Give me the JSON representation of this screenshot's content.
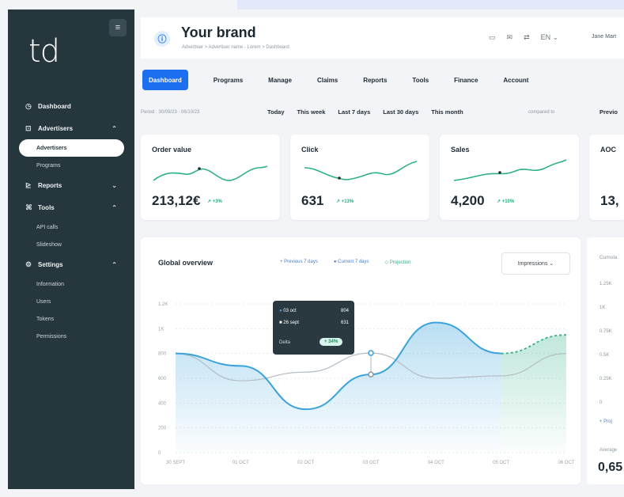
{
  "sidebar": {
    "logo": "td",
    "collapse_icon": "≡",
    "items": [
      {
        "label": "Dashboard",
        "icon": "◷",
        "type": "main"
      },
      {
        "label": "Advertisers",
        "icon": "⊡",
        "type": "main",
        "chev": "⌃"
      },
      {
        "label": "Advertisers",
        "type": "sub",
        "active": true
      },
      {
        "label": "Programs",
        "type": "sub"
      },
      {
        "label": "Reports",
        "icon": "⊵",
        "type": "main",
        "chev": "⌄"
      },
      {
        "label": "Tools",
        "icon": "⌘",
        "type": "main",
        "chev": "⌃"
      },
      {
        "label": "API calls",
        "type": "sub"
      },
      {
        "label": "Slideshow",
        "type": "sub"
      },
      {
        "label": "Settings",
        "icon": "⚙",
        "type": "main",
        "chev": "⌃"
      },
      {
        "label": "Information",
        "type": "sub"
      },
      {
        "label": "Users",
        "type": "sub"
      },
      {
        "label": "Tokens",
        "type": "sub"
      },
      {
        "label": "Permissions",
        "type": "sub"
      }
    ]
  },
  "header": {
    "brand_icon": "ⓘ",
    "title": "Your brand",
    "breadcrumb": "Advertiser  >  Advertiser name - Lorem  >  Dashboard",
    "user": "Jane Mart"
  },
  "tabs": [
    "Dashboard",
    "Programs",
    "Manage",
    "Claims",
    "Reports",
    "Tools",
    "Finance",
    "Account"
  ],
  "period": {
    "label": "Period : 30/09/23 - 06/10/23",
    "buttons": [
      "Today",
      "This week",
      "Last 7 days",
      "Last 30 days",
      "This month"
    ],
    "compared": "compared to",
    "previous": "Previo"
  },
  "kpis": [
    {
      "label": "Order value",
      "value": "213,12€",
      "change": "+3%"
    },
    {
      "label": "Click",
      "value": "631",
      "change": "+13%"
    },
    {
      "label": "Sales",
      "value": "4,200",
      "change": "+10%"
    },
    {
      "label": "AOC",
      "value": "13,"
    }
  ],
  "overview": {
    "title": "Global overview",
    "legend": [
      "Previous 7 days",
      "Current 7 days",
      "Projection"
    ],
    "select": "Impressions",
    "tooltip": {
      "row1": {
        "label": "03 oct",
        "value": "804"
      },
      "row2": {
        "label": "26 sept",
        "value": "631"
      },
      "delta_label": "Delta",
      "delta_value": "+ 34%"
    }
  },
  "chart_data": {
    "type": "line",
    "categories": [
      "30 SEPT",
      "01 OCT",
      "02 OCT",
      "03 OCT",
      "04 OCT",
      "05 OCT",
      "06 OCT"
    ],
    "ylim": [
      0,
      1200
    ],
    "y_ticks": [
      "0",
      "200",
      "400",
      "600",
      "800",
      "1K",
      "1.2K"
    ],
    "series": [
      {
        "name": "Previous 7 days",
        "values": [
          800,
          580,
          650,
          804,
          600,
          620,
          800
        ]
      },
      {
        "name": "Current 7 days",
        "values": [
          800,
          700,
          350,
          631,
          1050,
          800,
          null
        ]
      },
      {
        "name": "Projection",
        "values": [
          null,
          null,
          null,
          null,
          null,
          800,
          950
        ]
      }
    ]
  },
  "rpanel": {
    "title": "Cumula",
    "ticks": [
      "1.25K",
      "1K",
      "0.75K",
      "0.5K",
      "0.25K",
      "0"
    ],
    "link": "+ Proj",
    "avg_label": "Average",
    "avg_value": "0,65"
  },
  "colors": {
    "accent": "#1d6ff1",
    "sidebar": "#26363d",
    "line_blue": "#3aa3dc",
    "line_green": "#2fb08a",
    "line_grey": "#b6c0c6"
  }
}
